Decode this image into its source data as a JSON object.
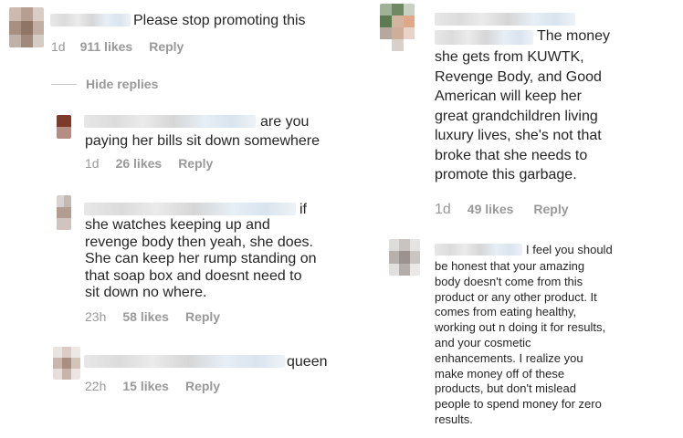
{
  "left_column": {
    "top_comment": {
      "text": "Please stop promoting this",
      "time": "1d",
      "likes": "911 likes",
      "reply": "Reply"
    },
    "hide_replies": "Hide replies",
    "replies": [
      {
        "first_line": "are you",
        "rest": "paying her bills sit down somewhere",
        "time": "1d",
        "likes": "26 likes",
        "reply": "Reply"
      },
      {
        "first_line": "if",
        "rest": "she watches keeping up and\nrevenge body then yeah, she does.\nShe can keep her rump standing on\nthat soap box and doesnt need to\nsit down no where.",
        "time": "23h",
        "likes": "58 likes",
        "reply": "Reply"
      },
      {
        "first_line": "queen",
        "time": "22h",
        "likes": "15 likes",
        "reply": "Reply"
      }
    ]
  },
  "right_column": {
    "comment_1": {
      "first_line": "The money",
      "rest": "she gets from KUWTK,\nRevenge Body, and Good\nAmerican will keep her\ngreat grandchildren living\nluxury lives, she's not that\nbroke that she needs to\npromote this garbage.",
      "time": "1d",
      "likes": "49 likes",
      "reply": "Reply"
    },
    "comment_2": {
      "first_line": "I feel you should",
      "rest": "be honest that your amazing\nbody doesn't come from this\nproduct or any other product. It\ncomes from eating healthy,\nworking out n doing it for results,\nand your cosmetic\nenhancements. I realize you\nmake money off of these\nproducts, but don't mislead\npeople to spend money for zero\nresults."
    }
  }
}
